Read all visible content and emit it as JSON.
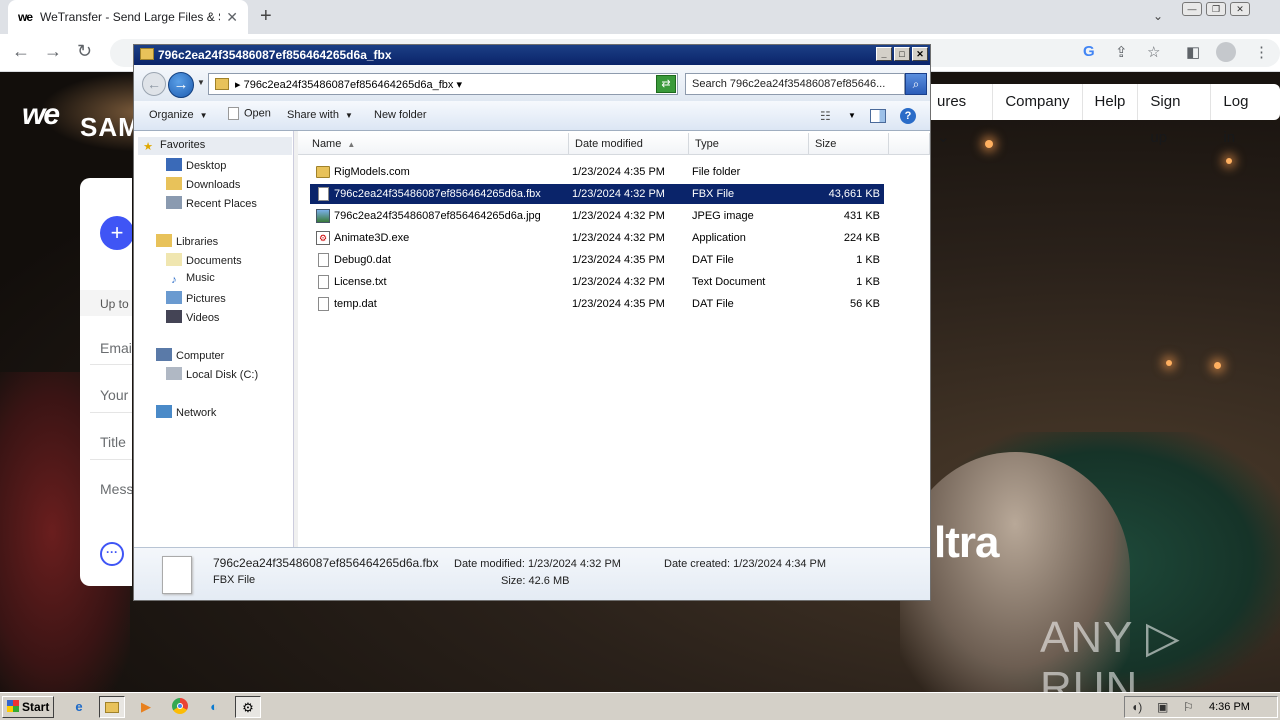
{
  "browser": {
    "tab_title": "WeTransfer - Send Large Files & Sha",
    "tab_favicon": "we"
  },
  "website": {
    "logo": "we",
    "partial_brand": "SAM",
    "nav": [
      "ures ⌄",
      "Company",
      "Help",
      "Sign up",
      "Log in"
    ],
    "upload_limit": "Up to",
    "fields": [
      "Emai",
      "Your",
      "Title",
      "Mess"
    ],
    "hero_partial": "ltra",
    "watermark": "ANY ▷ RUN"
  },
  "explorer": {
    "title": "796c2ea24f35486087ef856464265d6a_fbx",
    "address": "796c2ea24f35486087ef856464265d6a_fbx",
    "search_placeholder": "Search 796c2ea24f35486087ef85646...",
    "commands": {
      "organize": "Organize",
      "open": "Open",
      "share_with": "Share with",
      "new_folder": "New folder"
    },
    "nav_tree": {
      "favorites": "Favorites",
      "desktop": "Desktop",
      "downloads": "Downloads",
      "recent_places": "Recent Places",
      "libraries": "Libraries",
      "documents": "Documents",
      "music": "Music",
      "pictures": "Pictures",
      "videos": "Videos",
      "computer": "Computer",
      "local_disk": "Local Disk (C:)",
      "network": "Network"
    },
    "columns": {
      "name": "Name",
      "date_modified": "Date modified",
      "type": "Type",
      "size": "Size"
    },
    "files": [
      {
        "name": "RigModels.com",
        "date": "1/23/2024 4:35 PM",
        "type": "File folder",
        "size": "",
        "icon": "folder-icon"
      },
      {
        "name": "796c2ea24f35486087ef856464265d6a.fbx",
        "date": "1/23/2024 4:32 PM",
        "type": "FBX File",
        "size": "43,661 KB",
        "icon": "file-icon"
      },
      {
        "name": "796c2ea24f35486087ef856464265d6a.jpg",
        "date": "1/23/2024 4:32 PM",
        "type": "JPEG image",
        "size": "431 KB",
        "icon": "image-icon"
      },
      {
        "name": "Animate3D.exe",
        "date": "1/23/2024 4:32 PM",
        "type": "Application",
        "size": "224 KB",
        "icon": "exe-icon"
      },
      {
        "name": "Debug0.dat",
        "date": "1/23/2024 4:35 PM",
        "type": "DAT File",
        "size": "1 KB",
        "icon": "file-icon"
      },
      {
        "name": "License.txt",
        "date": "1/23/2024 4:32 PM",
        "type": "Text Document",
        "size": "1 KB",
        "icon": "text-file-icon"
      },
      {
        "name": "temp.dat",
        "date": "1/23/2024 4:35 PM",
        "type": "DAT File",
        "size": "56 KB",
        "icon": "file-icon"
      }
    ],
    "details": {
      "filename": "796c2ea24f35486087ef856464265d6a.fbx",
      "filetype": "FBX File",
      "date_modified": "Date modified: 1/23/2024 4:32 PM",
      "size": "Size: 42.6 MB",
      "date_created": "Date created: 1/23/2024 4:34 PM"
    }
  },
  "taskbar": {
    "start": "Start",
    "clock": "4:36 PM"
  }
}
